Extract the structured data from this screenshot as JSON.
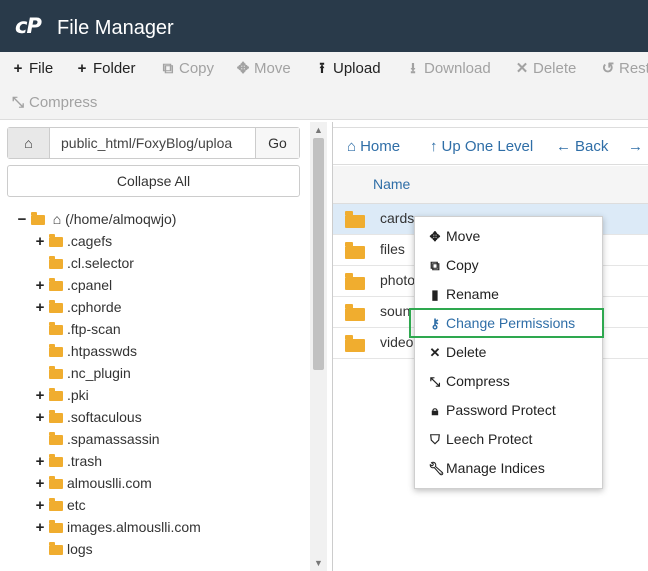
{
  "app": {
    "logo": "cP",
    "title": "File Manager"
  },
  "toolbar": {
    "file": "File",
    "folder": "Folder",
    "copy": "Copy",
    "move": "Move",
    "upload": "Upload",
    "download": "Download",
    "delete": "Delete",
    "restore": "Rest",
    "compress": "Compress"
  },
  "path": {
    "value": "public_html/FoxyBlog/uploa",
    "go_label": "Go"
  },
  "collapse_label": "Collapse All",
  "tree": {
    "root": "(/home/almoqwjo)",
    "items": [
      {
        "label": ".cagefs",
        "expandable": true
      },
      {
        "label": ".cl.selector",
        "expandable": false
      },
      {
        "label": ".cpanel",
        "expandable": true
      },
      {
        "label": ".cphorde",
        "expandable": true
      },
      {
        "label": ".ftp-scan",
        "expandable": false
      },
      {
        "label": ".htpasswds",
        "expandable": false
      },
      {
        "label": ".nc_plugin",
        "expandable": false
      },
      {
        "label": ".pki",
        "expandable": true
      },
      {
        "label": ".softaculous",
        "expandable": true
      },
      {
        "label": ".spamassassin",
        "expandable": false
      },
      {
        "label": ".trash",
        "expandable": true
      },
      {
        "label": "almouslli.com",
        "expandable": true
      },
      {
        "label": "etc",
        "expandable": true
      },
      {
        "label": "images.almouslli.com",
        "expandable": true
      },
      {
        "label": "logs",
        "expandable": false
      }
    ]
  },
  "nav": {
    "home": "Home",
    "up": "Up One Level",
    "back": "Back",
    "forward": ""
  },
  "table": {
    "name_header": "Name"
  },
  "files": [
    {
      "name": "cards",
      "selected": true
    },
    {
      "name": "files",
      "selected": false
    },
    {
      "name": "photo",
      "selected": false
    },
    {
      "name": "soun",
      "selected": false
    },
    {
      "name": "video",
      "selected": false
    }
  ],
  "context_menu": {
    "items": [
      {
        "label": "Move",
        "icon": "move-icon"
      },
      {
        "label": "Copy",
        "icon": "copy-icon"
      },
      {
        "label": "Rename",
        "icon": "file-icon"
      },
      {
        "label": "Change Permissions",
        "icon": "key-icon",
        "active": true
      },
      {
        "label": "Delete",
        "icon": "close-icon"
      },
      {
        "label": "Compress",
        "icon": "compress-icon"
      },
      {
        "label": "Password Protect",
        "icon": "lock-icon"
      },
      {
        "label": "Leech Protect",
        "icon": "shield-icon"
      },
      {
        "label": "Manage Indices",
        "icon": "wrench-icon"
      }
    ]
  },
  "colors": {
    "header_bg": "#293a4a",
    "link": "#2f6ea7",
    "folder": "#f0ad2f",
    "highlight": "#2ea84f",
    "selected_row": "#dceaf7"
  }
}
